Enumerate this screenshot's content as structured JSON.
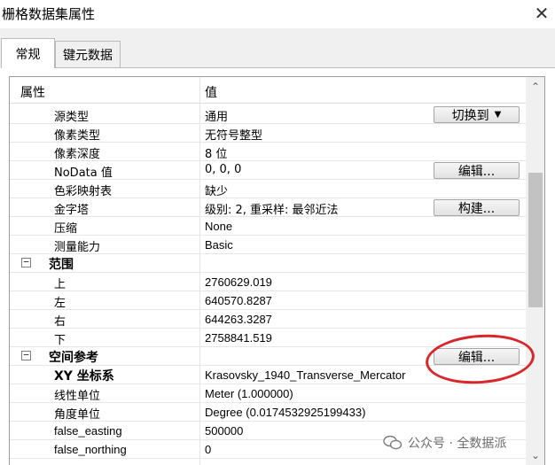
{
  "window": {
    "title": "栅格数据集属性",
    "close_glyph": "✕"
  },
  "tabs": [
    {
      "label": "常规",
      "selected": true
    },
    {
      "label": "键元数据",
      "selected": false
    }
  ],
  "grid": {
    "header_property": "属性",
    "header_value": "值",
    "rows": [
      {
        "name": "源类型",
        "value": "通用",
        "button": "切换到"
      },
      {
        "name": "像素类型",
        "value": "无符号整型"
      },
      {
        "name": "像素深度",
        "value": "8 位"
      },
      {
        "name": "NoData 值",
        "value": "0, 0, 0",
        "button": "编辑..."
      },
      {
        "name": "色彩映射表",
        "value": "缺少"
      },
      {
        "name": "金字塔",
        "value": "级别: 2, 重采样: 最邻近法",
        "button": "构建..."
      },
      {
        "name": "压缩",
        "value": "None"
      },
      {
        "name": "测量能力",
        "value": "Basic"
      },
      {
        "name": "范围",
        "section": true,
        "expander": "−"
      },
      {
        "name": "上",
        "value": "2760629.019"
      },
      {
        "name": "左",
        "value": "640570.8287"
      },
      {
        "name": "右",
        "value": "644263.3287"
      },
      {
        "name": "下",
        "value": "2758841.519"
      },
      {
        "name": "空间参考",
        "section": true,
        "expander": "−",
        "button": "编辑..."
      },
      {
        "name": "XY 坐标系",
        "value": "Krasovsky_1940_Transverse_Mercator"
      },
      {
        "name": "线性单位",
        "value": "Meter (1.000000)"
      },
      {
        "name": "角度单位",
        "value": "Degree (0.0174532925199433)"
      },
      {
        "name": "false_easting",
        "value": "500000"
      },
      {
        "name": "false_northing",
        "value": "0"
      }
    ]
  },
  "scrollbar": {
    "up_glyph": "⌃",
    "down_glyph": "⌄"
  },
  "watermark": {
    "text": "公众号 · 全数据派"
  },
  "colors": {
    "annotation": "#d8262a",
    "selected_tab": "#ffffff",
    "chrome": "#f0f0f0"
  }
}
